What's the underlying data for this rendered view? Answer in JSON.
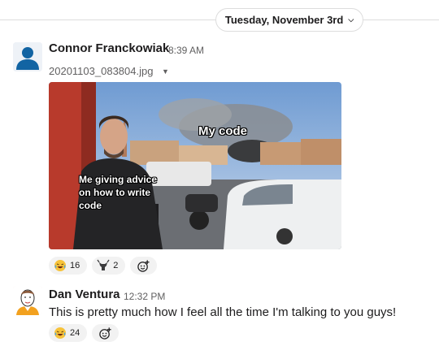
{
  "date_divider": {
    "label": "Tuesday, November 3rd"
  },
  "messages": [
    {
      "author": "Connor Franckowiak",
      "time": "8:39 AM",
      "attachment": {
        "filename": "20201103_083804.jpg",
        "caption_top": "My code",
        "caption_bottom": "Me giving advice on how to write code"
      },
      "reactions": [
        {
          "emoji": "laughing-tears-icon",
          "count": "16"
        },
        {
          "emoji": "goat-icon",
          "count": "2"
        }
      ]
    },
    {
      "author": "Dan Ventura",
      "time": "12:32 PM",
      "text": "This is pretty much how I feel all the time I'm talking to you guys!",
      "reactions": [
        {
          "emoji": "laughing-tears-icon",
          "count": "24"
        }
      ]
    }
  ],
  "colors": {
    "text_primary": "#1d1c1d",
    "text_secondary": "#616061",
    "reaction_bg": "#f2f2f2",
    "divider": "#dddddd"
  }
}
